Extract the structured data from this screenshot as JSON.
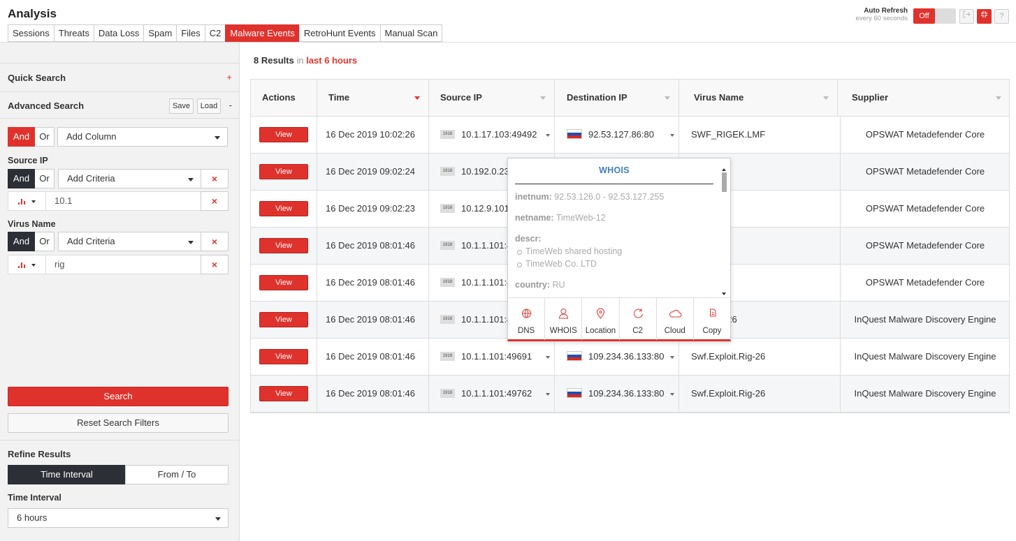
{
  "app": {
    "title": "Analysis"
  },
  "tabs": [
    {
      "label": "Sessions",
      "active": false
    },
    {
      "label": "Threats",
      "active": false
    },
    {
      "label": "Data Loss",
      "active": false
    },
    {
      "label": "Spam",
      "active": false
    },
    {
      "label": "Files",
      "active": false
    },
    {
      "label": "C2",
      "active": false
    },
    {
      "label": "Malware Events",
      "active": true
    },
    {
      "label": "RetroHunt Events",
      "active": false
    },
    {
      "label": "Manual Scan",
      "active": false
    }
  ],
  "auto_refresh": {
    "title": "Auto Refresh",
    "subtitle": "every 60 seconds",
    "state": "Off",
    "help": "?"
  },
  "sidebar": {
    "quick_search": "Quick Search",
    "quick_plus": "+",
    "advanced_search": "Advanced Search",
    "save": "Save",
    "load": "Load",
    "collapse": "-",
    "and": "And",
    "or": "Or",
    "add_column": "Add Column",
    "source_ip_label": "Source IP",
    "virus_name_label": "Virus Name",
    "add_criteria": "Add Criteria",
    "remove": "×",
    "source_ip_value": "10.1",
    "virus_name_value": "rig",
    "search": "Search",
    "reset": "Reset Search Filters",
    "refine": "Refine Results",
    "time_interval_tab": "Time Interval",
    "from_to_tab": "From / To",
    "time_interval_label": "Time Interval",
    "time_interval_value": "6 hours"
  },
  "results": {
    "count": "8 Results",
    "in": "in",
    "range": "last 6 hours"
  },
  "table": {
    "headers": [
      "Actions",
      "Time",
      "Source IP",
      "Destination IP",
      "Virus Name",
      "Supplier"
    ],
    "view_label": "View",
    "ip_badge": "1918",
    "rows": [
      {
        "time": "16 Dec 2019 10:02:26",
        "src": "10.1.17.103:49492",
        "dst": "92.53.127.86:80",
        "virus": "SWF_RIGEK.LMF",
        "supplier": "OPSWAT Metadefender Core"
      },
      {
        "time": "16 Dec 2019 09:02:24",
        "src": "10.192.0.23",
        "dst": "",
        "virus": "t-Rigkit.i",
        "supplier": "OPSWAT Metadefender Core"
      },
      {
        "time": "16 Dec 2019 09:02:23",
        "src": "10.12.9.101:",
        "dst": "",
        "virus": "loit-Rig.g",
        "supplier": "OPSWAT Metadefender Core"
      },
      {
        "time": "16 Dec 2019 08:01:46",
        "src": "10.1.1.101:49",
        "dst": "",
        "virus": "t-Rigkit.j",
        "supplier": "OPSWAT Metadefender Core"
      },
      {
        "time": "16 Dec 2019 08:01:46",
        "src": "10.1.1.101:49",
        "dst": "",
        "virus": "t-Rigkit.i",
        "supplier": "OPSWAT Metadefender Core"
      },
      {
        "time": "16 Dec 2019 08:01:46",
        "src": "10.1.1.101:49",
        "dst": "",
        "virus": "ploit.Rig-26",
        "supplier": "InQuest Malware Discovery Engine"
      },
      {
        "time": "16 Dec 2019 08:01:46",
        "src": "10.1.1.101:49691",
        "dst": "109.234.36.133:80",
        "virus": "Swf.Exploit.Rig-26",
        "supplier": "InQuest Malware Discovery Engine"
      },
      {
        "time": "16 Dec 2019 08:01:46",
        "src": "10.1.1.101:49762",
        "dst": "109.234.36.133:80",
        "virus": "Swf.Exploit.Rig-26",
        "supplier": "InQuest Malware Discovery Engine"
      }
    ]
  },
  "whois": {
    "title": "WHOIS",
    "inetnum_key": "inetnum:",
    "inetnum": "92.53.126.0 - 92.53.127.255",
    "netname_key": "netname:",
    "netname": "TimeWeb-12",
    "descr_key": "descr:",
    "descr": [
      "TimeWeb shared hosting",
      "TimeWeb Co. LTD"
    ],
    "country_key": "country:",
    "country": "RU",
    "actions": [
      "DNS",
      "WHOIS",
      "Location",
      "C2",
      "Cloud",
      "Copy"
    ]
  },
  "colors": {
    "accent": "#e0322c",
    "dark": "#2c2f36",
    "link": "#3f7fc0"
  }
}
